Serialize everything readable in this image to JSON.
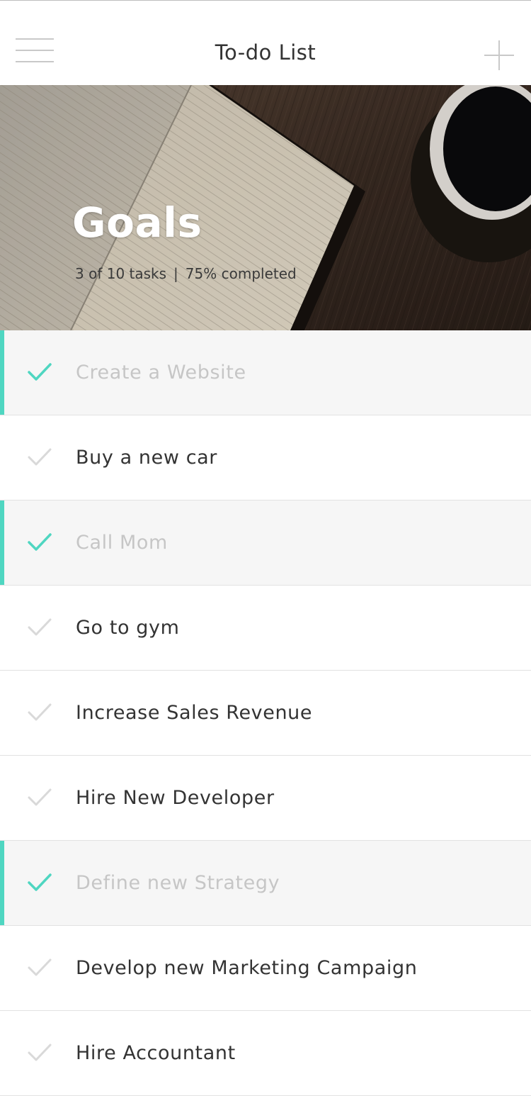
{
  "header": {
    "title": "To-do List",
    "menu_icon": "hamburger-menu-icon",
    "add_icon": "plus-icon"
  },
  "hero": {
    "title": "Goals",
    "tasks_summary": "3 of 10 tasks",
    "separator": "|",
    "completion": "75% completed"
  },
  "colors": {
    "accent": "#4fd6c1",
    "text": "#333333",
    "done_text": "#c6c6c6",
    "done_background": "#f6f6f6",
    "unchecked_icon": "#d9d9d9"
  },
  "tasks": [
    {
      "label": "Create a Website",
      "done": true
    },
    {
      "label": "Buy a new car",
      "done": false
    },
    {
      "label": "Call Mom",
      "done": true
    },
    {
      "label": "Go to gym",
      "done": false
    },
    {
      "label": "Increase Sales Revenue",
      "done": false
    },
    {
      "label": "Hire New Developer",
      "done": false
    },
    {
      "label": "Define new Strategy",
      "done": true
    },
    {
      "label": "Develop new Marketing Campaign",
      "done": false
    },
    {
      "label": "Hire Accountant",
      "done": false
    }
  ]
}
